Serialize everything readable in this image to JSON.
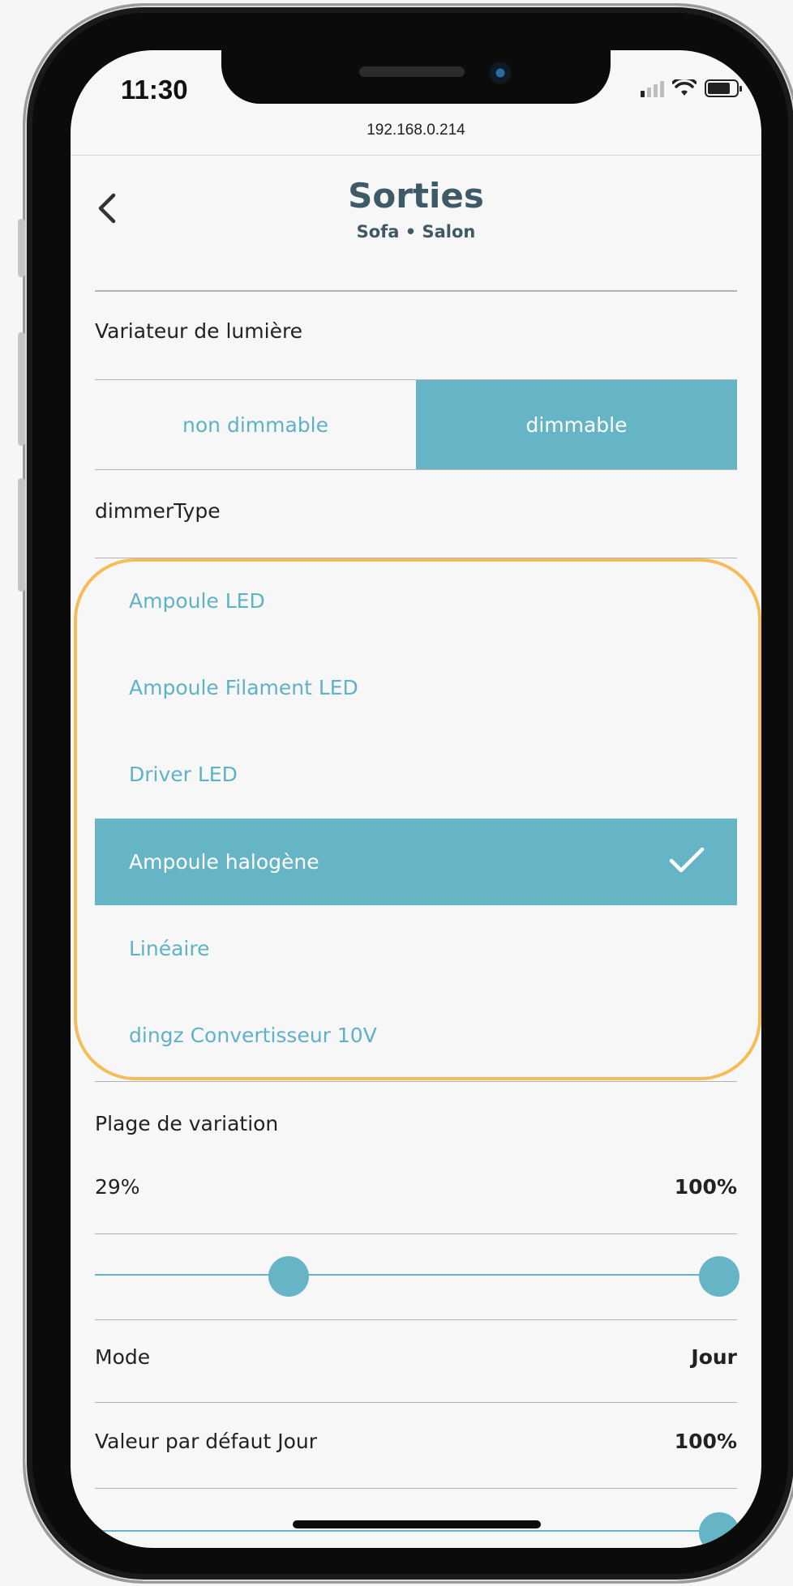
{
  "status": {
    "time": "11:30"
  },
  "browser": {
    "url": "192.168.0.214"
  },
  "header": {
    "title": "Sorties",
    "subtitle": "Sofa • Salon"
  },
  "dimmer": {
    "label": "Variateur de lumière",
    "options": [
      "non dimmable",
      "dimmable"
    ],
    "selected": "dimmable"
  },
  "dimmer_type": {
    "label": "dimmerType",
    "items": [
      "Ampoule LED",
      "Ampoule Filament LED",
      "Driver LED",
      "Ampoule halogène",
      "Linéaire",
      "dingz Convertisseur 10V"
    ],
    "selected": "Ampoule halogène"
  },
  "range": {
    "label": "Plage de variation",
    "min_label": "29%",
    "max_label": "100%",
    "min_value": 29,
    "max_value": 100
  },
  "mode": {
    "label": "Mode",
    "value": "Jour"
  },
  "default_day": {
    "label": "Valeur par défaut Jour",
    "value": "100%",
    "level": 100
  },
  "colors": {
    "accent": "#66b5c6",
    "highlight": "#f7bc5a",
    "title": "#3d5a66"
  }
}
